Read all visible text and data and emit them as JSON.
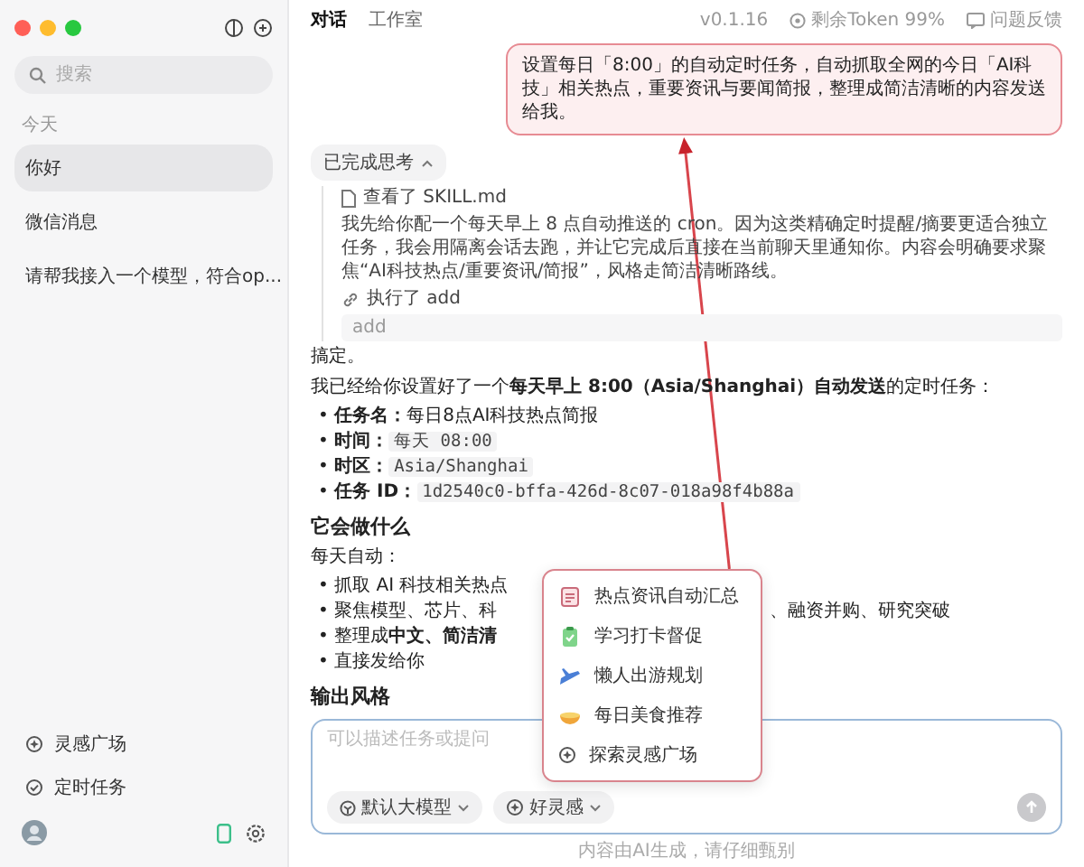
{
  "sidebar": {
    "search": {
      "placeholder": "搜索"
    },
    "section_label": "今天",
    "items": [
      {
        "label": "你好",
        "selected": true
      },
      {
        "label": "微信消息",
        "selected": false
      },
      {
        "label": "请帮我接入一个模型，符合op...",
        "selected": false
      }
    ],
    "bottom_links": [
      {
        "label": "灵感广场",
        "kind": "spark"
      },
      {
        "label": "定时任务",
        "kind": "clock"
      }
    ]
  },
  "topbar": {
    "tabs": [
      {
        "label": "对话",
        "selected": true
      },
      {
        "label": "工作室",
        "selected": false
      }
    ],
    "version": "v0.1.16",
    "token": "剩余Token 99%",
    "feedback": "问题反馈"
  },
  "prompt": "设置每日「8:00」的自动定时任务，自动抓取全网的今日「AI科技」相关热点，重要资讯与要闻简报，整理成简洁清晰的内容发送给我。",
  "thinking": {
    "label": "已完成思考",
    "expanded": true,
    "steps": [
      {
        "kind": "file",
        "text": "查看了 SKILL.md"
      },
      {
        "kind": "text",
        "text": "我先给你配一个每天早上 8 点自动推送的 cron。因为这类精确定时提醒/摘要更适合独立任务，我会用隔离会话去跑，并让它完成后直接在当前聊天里通知你。内容会明确要求聚焦“AI科技热点/重要资讯/简报”，风格走简洁清晰路线。"
      },
      {
        "kind": "tool",
        "text": "执行了 add",
        "output": "add"
      }
    ]
  },
  "answer": {
    "lead": "搞定。",
    "intro": "我已经给你设置好了一个**每天早上 8:00（Asia/Shanghai）自动发送**的定时任务：",
    "facts": [
      {
        "marker": "•",
        "label": "任务名：",
        "value": "每日8点AI科技热点简报",
        "kind": "text"
      },
      {
        "marker": "•",
        "label": "时间：",
        "value": "每天 08:00",
        "kind": "code"
      },
      {
        "marker": "•",
        "label": "时区：",
        "value": "Asia/Shanghai",
        "kind": "code"
      },
      {
        "marker": "•",
        "label": "任务 ID：",
        "value": "1d2540c0-bffa-426d-8c07-018a98f4b88a",
        "kind": "code"
      }
    ],
    "heading": "它会做什么",
    "sub": "每天自动：",
    "bullets": [
      {
        "marker": "•",
        "text": "抓取 AI 科技相关热点"
      },
      {
        "marker": "•",
        "text": "聚焦模型、芯片、科",
        "tail": "、融资并购、研究突破"
      },
      {
        "marker": "•",
        "text": "整理成**中文、简洁清**"
      },
      {
        "marker": "•",
        "text": "直接发给你"
      }
    ],
    "heading2": "输出风格"
  },
  "menu": [
    {
      "label": "热点资讯自动汇总",
      "kind": "notes"
    },
    {
      "label": "学习打卡督促",
      "kind": "clipboard"
    },
    {
      "label": "懒人出游规划",
      "kind": "plane"
    },
    {
      "label": "每日美食推荐",
      "kind": "bowl"
    },
    {
      "label": "探索灵感广场",
      "kind": "spark"
    }
  ],
  "composer": {
    "placeholder": "可以描述任务或提问",
    "model_button": "默认大模型",
    "idea_button": "好灵感",
    "send_disabled": true
  },
  "footer": "内容由AI生成，请仔细甄别"
}
